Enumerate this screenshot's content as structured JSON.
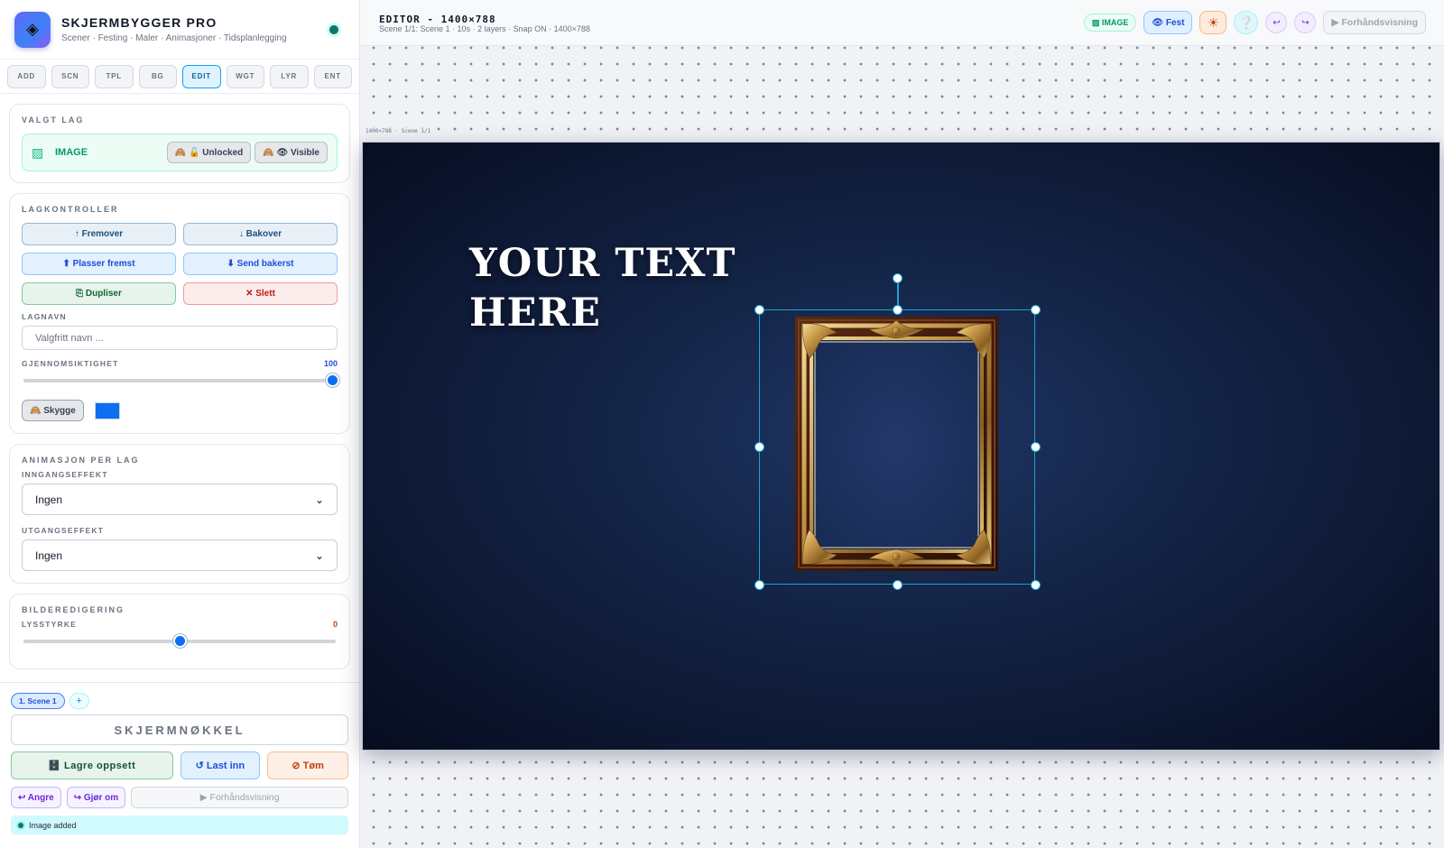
{
  "app": {
    "title": "SKJERMBYGGER PRO",
    "subtitle": "Scener · Festing · Maler · Animasjoner · Tidsplanlegging",
    "logo_glyph": "◈",
    "status_color": "#0f766e"
  },
  "tabs": [
    {
      "label": "ADD",
      "active": false
    },
    {
      "label": "SCN",
      "active": false
    },
    {
      "label": "TPL",
      "active": false
    },
    {
      "label": "BG",
      "active": false
    },
    {
      "label": "EDIT",
      "active": true
    },
    {
      "label": "WGT",
      "active": false
    },
    {
      "label": "LYR",
      "active": false
    },
    {
      "label": "ENT",
      "active": false
    }
  ],
  "selected_layer": {
    "heading": "VALGT LAG",
    "type_label": "IMAGE",
    "lock_label": "🙈 🔓 Unlocked",
    "visible_label": "🙈 👁 Visible"
  },
  "layer_controls": {
    "heading": "LAGKONTROLLER",
    "forward": "↑ Fremover",
    "backward": "↓ Bakover",
    "to_front": "⬆ Plasser fremst",
    "to_back": "⬇ Send bakerst",
    "duplicate": "⎘ Dupliser",
    "delete": "✕ Slett",
    "name_label": "LAGNAVN",
    "name_placeholder": "Valgfritt navn ...",
    "opacity_label": "GJENNOMSIKTIGHET",
    "opacity_value": "100",
    "opacity_fraction": 1.0,
    "shadow_label": "🙈 Skygge",
    "shadow_color": "#0b6ff0"
  },
  "animation": {
    "heading": "ANIMASJON PER LAG",
    "entry_label": "INNGANGSEFFEKT",
    "entry_value": "Ingen",
    "exit_label": "UTGANGSEFFEKT",
    "exit_value": "Ingen"
  },
  "image_edit": {
    "heading": "BILDEREDIGERING",
    "brightness_label": "LYSSTYRKE",
    "brightness_value": "0",
    "brightness_fraction": 0.5
  },
  "dock": {
    "scene_chip": "1. Scene 1",
    "add_scene": "+",
    "screen_key": "SKJERMNØKKEL",
    "save": "🗄️ Lagre oppsett",
    "load": "↺ Last inn",
    "clear": "⊘ Tøm",
    "undo": "↩ Angre",
    "redo": "↪ Gjør om",
    "preview": "▶ Forhåndsvisning",
    "status": "Image added"
  },
  "topbar": {
    "title": "EDITOR - 1400×788",
    "subtitle": "Scene 1/1: Scene 1 · 10s · 2 layers · Snap ON · 1400×788",
    "badge": "▨ IMAGE",
    "pin": "👁 Fest",
    "sun_icon": "☀",
    "help_icon": "❔",
    "undo_icon": "↩",
    "redo_icon": "↪",
    "preview": "▶ Forhåndsvisning"
  },
  "canvas": {
    "caption": "1400×788 · Scene 1/1",
    "text_line1": "YOUR TEXT",
    "text_line2": "HERE",
    "selection_color": "#1ba3d6"
  }
}
